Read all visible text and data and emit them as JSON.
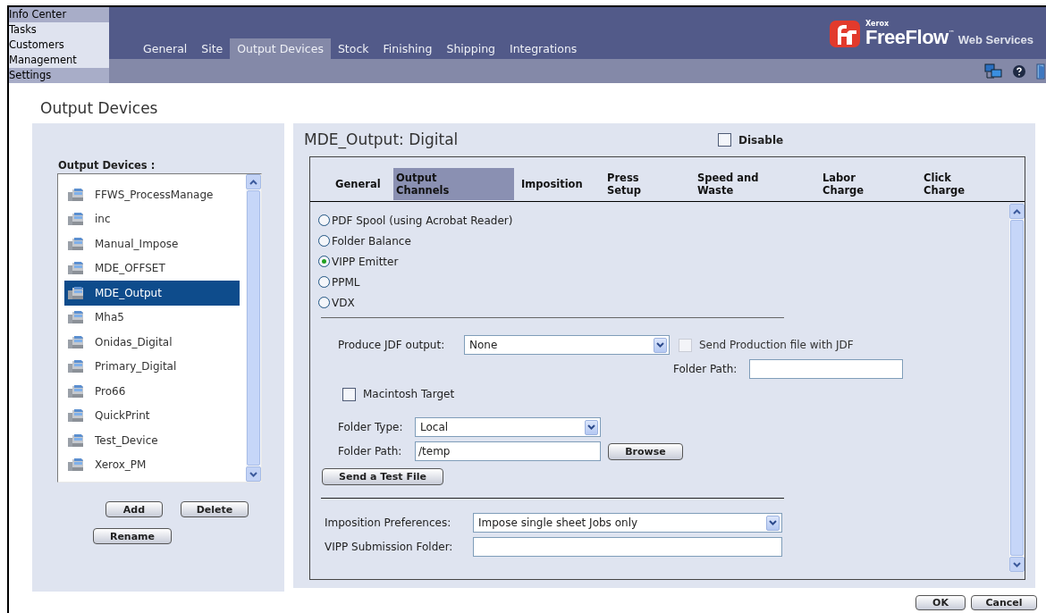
{
  "side_nav": [
    {
      "label": "Info Center",
      "highlighted": true
    },
    {
      "label": "Tasks",
      "highlighted": false
    },
    {
      "label": "Customers",
      "highlighted": false
    },
    {
      "label": "Management",
      "highlighted": false
    },
    {
      "label": "Settings",
      "highlighted": true
    }
  ],
  "tabs": [
    {
      "label": "General",
      "selected": false
    },
    {
      "label": "Site",
      "selected": false
    },
    {
      "label": "Output Devices",
      "selected": true
    },
    {
      "label": "Stock",
      "selected": false
    },
    {
      "label": "Finishing",
      "selected": false
    },
    {
      "label": "Shipping",
      "selected": false
    },
    {
      "label": "Integrations",
      "selected": false
    }
  ],
  "logo": {
    "company": "Xerox",
    "product": "FreeFlow",
    "trademark": "™",
    "suffix": "Web Services"
  },
  "page_title": "Output Devices",
  "device_panel": {
    "label": "Output Devices :",
    "devices": [
      {
        "name": "FFWS_ProcessManage",
        "selected": false
      },
      {
        "name": "inc",
        "selected": false
      },
      {
        "name": "Manual_Impose",
        "selected": false
      },
      {
        "name": "MDE_OFFSET",
        "selected": false
      },
      {
        "name": "MDE_Output",
        "selected": true
      },
      {
        "name": "Mha5",
        "selected": false
      },
      {
        "name": "Onidas_Digital",
        "selected": false
      },
      {
        "name": "Primary_Digital",
        "selected": false
      },
      {
        "name": "Pro66",
        "selected": false
      },
      {
        "name": "QuickPrint",
        "selected": false
      },
      {
        "name": "Test_Device",
        "selected": false
      },
      {
        "name": "Xerox_PM",
        "selected": false
      }
    ],
    "buttons": [
      "Add",
      "Delete",
      "Rename"
    ]
  },
  "detail": {
    "title": "MDE_Output: Digital",
    "disable": {
      "label": "Disable",
      "checked": false
    },
    "tabs": [
      {
        "label": "General",
        "selected": false
      },
      {
        "label": "Output Channels",
        "selected": true
      },
      {
        "label": "Imposition",
        "selected": false
      },
      {
        "label": "Press Setup",
        "selected": false
      },
      {
        "label": "Speed and Waste",
        "selected": false
      },
      {
        "label": "Labor Charge",
        "selected": false
      },
      {
        "label": "Click Charge",
        "selected": false
      }
    ],
    "channels": [
      {
        "label": "PDF Spool (using Acrobat Reader)",
        "selected": false
      },
      {
        "label": "Folder Balance",
        "selected": false
      },
      {
        "label": "VIPP Emitter",
        "selected": true
      },
      {
        "label": "PPML",
        "selected": false
      },
      {
        "label": "VDX",
        "selected": false
      }
    ],
    "jdf_output": {
      "label": "Produce JDF output:",
      "value": "None"
    },
    "send_production": {
      "label": "Send Production file with JDF",
      "checked": false,
      "disabled": true
    },
    "jdf_folder_path": {
      "label": "Folder Path:"
    },
    "macintosh_target": {
      "label": "Macintosh Target",
      "checked": false
    },
    "folder_type": {
      "label": "Folder Type:",
      "value": "Local"
    },
    "folder_path": {
      "label": "Folder Path:",
      "value": "/temp"
    },
    "browse_button": "Browse",
    "test_button": "Send a Test File",
    "imposition_preferences": {
      "label": "Imposition Preferences:",
      "value": "Impose single sheet Jobs only"
    },
    "vipp_folder": {
      "label": "VIPP Submission Folder:"
    }
  },
  "footer_buttons": [
    "OK",
    "Cancel"
  ]
}
